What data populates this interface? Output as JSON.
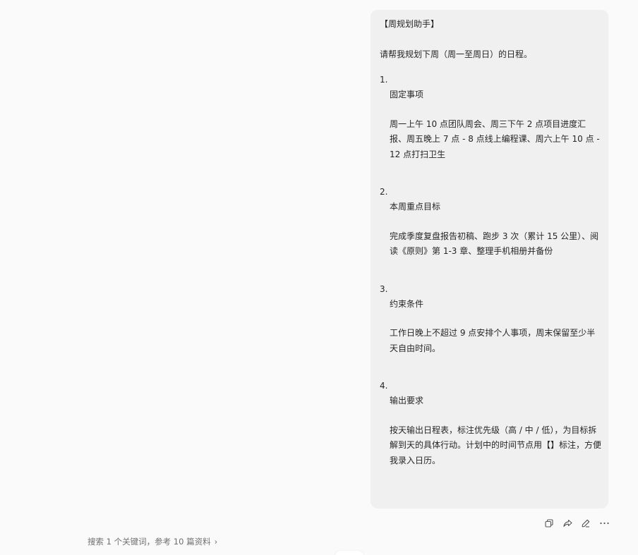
{
  "message": {
    "title": "【周规划助手】",
    "intro": "请帮我规划下周（周一至周日）的日程。",
    "sections": [
      {
        "number": "1.",
        "heading": "固定事项",
        "body": "周一上午 10 点团队周会、周三下午 2 点项目进度汇报、周五晚上 7 点 - 8 点线上编程课、周六上午 10 点 - 12 点打扫卫生"
      },
      {
        "number": "2.",
        "heading": "本周重点目标",
        "body": "完成季度复盘报告初稿、跑步 3 次（累计 15 公里）、阅读《原则》第 1-3 章、整理手机相册并备份"
      },
      {
        "number": "3.",
        "heading": "约束条件",
        "body": "工作日晚上不超过 9 点安排个人事项，周末保留至少半天自由时间。"
      },
      {
        "number": "4.",
        "heading": "输出要求",
        "body": "按天输出日程表，标注优先级（高 / 中 / 低），为目标拆解到天的具体行动。计划中的时间节点用【】标注，方便我录入日历。"
      }
    ]
  },
  "actions": {
    "icons": [
      "copy-icon",
      "share-icon",
      "edit-icon",
      "more-icon"
    ]
  },
  "search_ref": {
    "text": "搜索 1 个关键词，参考 10 篇资料",
    "chevron": "›"
  },
  "colors": {
    "page_bg": "#fafafa",
    "bubble_bg": "#f0f0f0",
    "text": "#262626",
    "muted": "#6e6e6e"
  }
}
